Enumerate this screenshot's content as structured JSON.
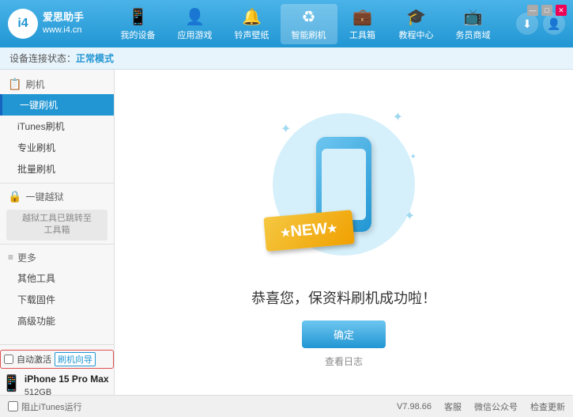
{
  "app": {
    "title": "爱思助手",
    "subtitle": "www.i4.cn"
  },
  "nav": {
    "tabs": [
      {
        "id": "my-device",
        "label": "我的设备",
        "icon": "📱"
      },
      {
        "id": "app-games",
        "label": "应用游戏",
        "icon": "👤"
      },
      {
        "id": "ringtone",
        "label": "铃声壁纸",
        "icon": "🔔"
      },
      {
        "id": "smart-flash",
        "label": "智能刷机",
        "icon": "♻"
      },
      {
        "id": "toolbox",
        "label": "工具箱",
        "icon": "💼"
      },
      {
        "id": "tutorial",
        "label": "教程中心",
        "icon": "🎓"
      },
      {
        "id": "service",
        "label": "务员商域",
        "icon": "📺"
      }
    ]
  },
  "subheader": {
    "prefix": "设备连接状态：",
    "mode": "正常模式"
  },
  "sidebar": {
    "flash_section": "刷机",
    "items": [
      {
        "id": "one-key-flash",
        "label": "一键刷机",
        "active": true
      },
      {
        "id": "itunes-flash",
        "label": "iTunes刷机"
      },
      {
        "id": "pro-flash",
        "label": "专业刷机"
      },
      {
        "id": "batch-flash",
        "label": "批量刷机"
      }
    ],
    "disabled_section": "一键越狱",
    "disabled_msg": "越狱工具已跳转至\n工具箱",
    "more_section": "更多",
    "more_items": [
      {
        "id": "other-tools",
        "label": "其他工具"
      },
      {
        "id": "download-firm",
        "label": "下载固件"
      },
      {
        "id": "advanced",
        "label": "高级功能"
      }
    ]
  },
  "content": {
    "new_label": "NEW",
    "success_text": "恭喜您，保资料刷机成功啦！",
    "confirm_btn": "确定",
    "view_log": "查看日志"
  },
  "footer": {
    "auto_activate_label": "自动激活",
    "guide_label": "刷机向导",
    "version": "V7.98.66",
    "links": [
      "客服",
      "微信公众号",
      "检查更新"
    ],
    "itunes_label": "阻止iTunes运行"
  },
  "device": {
    "name": "iPhone 15 Pro Max",
    "storage": "512GB",
    "type": "iPhone"
  }
}
